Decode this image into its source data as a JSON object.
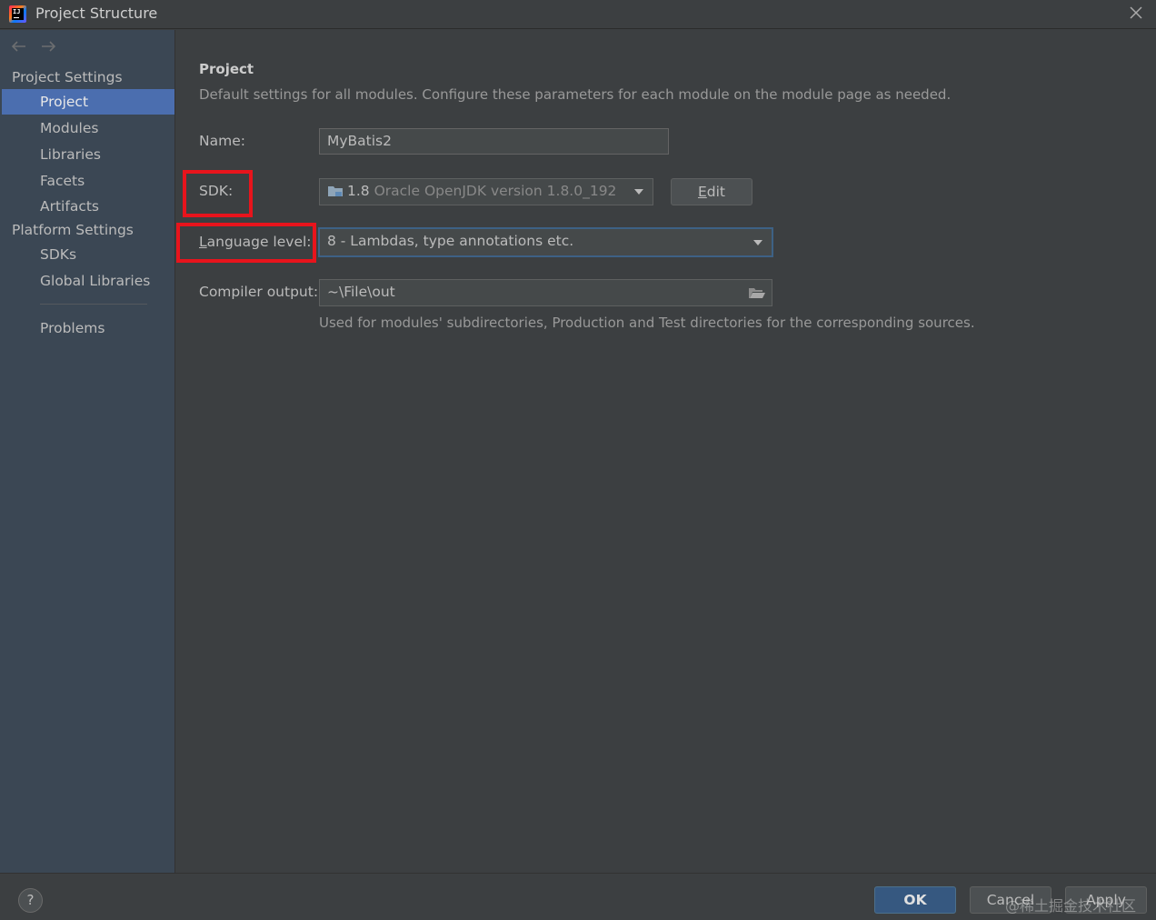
{
  "window": {
    "title": "Project Structure",
    "icon": "intellij-idea-icon"
  },
  "sidebar": {
    "back_icon": "arrow-left-icon",
    "forward_icon": "arrow-right-icon",
    "sections": [
      {
        "label": "Project Settings",
        "items": [
          "Project",
          "Modules",
          "Libraries",
          "Facets",
          "Artifacts"
        ]
      },
      {
        "label": "Platform Settings",
        "items": [
          "SDKs",
          "Global Libraries"
        ]
      }
    ],
    "problems": "Problems",
    "selected": "Project",
    "selection_color": "#4b6eaf"
  },
  "main": {
    "heading": "Project",
    "description": "Default settings for all modules. Configure these parameters for each module on the module page as needed.",
    "name": {
      "label": "Name:",
      "value": "MyBatis2"
    },
    "sdk": {
      "label": "SDK:",
      "version": "1.8",
      "detail": "Oracle OpenJDK version 1.8.0_192",
      "edit_label": "Edit"
    },
    "language_level": {
      "label": "Language level:",
      "value": "8 - Lambdas, type annotations etc."
    },
    "compiler_output": {
      "label": "Compiler output:",
      "value": "~\\File\\out",
      "hint": "Used for modules' subdirectories, Production and Test directories for the corresponding sources."
    }
  },
  "footer": {
    "help_label": "?",
    "ok_label": "OK",
    "cancel_label": "Cancel",
    "apply_label": "Apply",
    "watermark": "@稀土掘金技术社区"
  },
  "highlight_color": "#e8141c"
}
